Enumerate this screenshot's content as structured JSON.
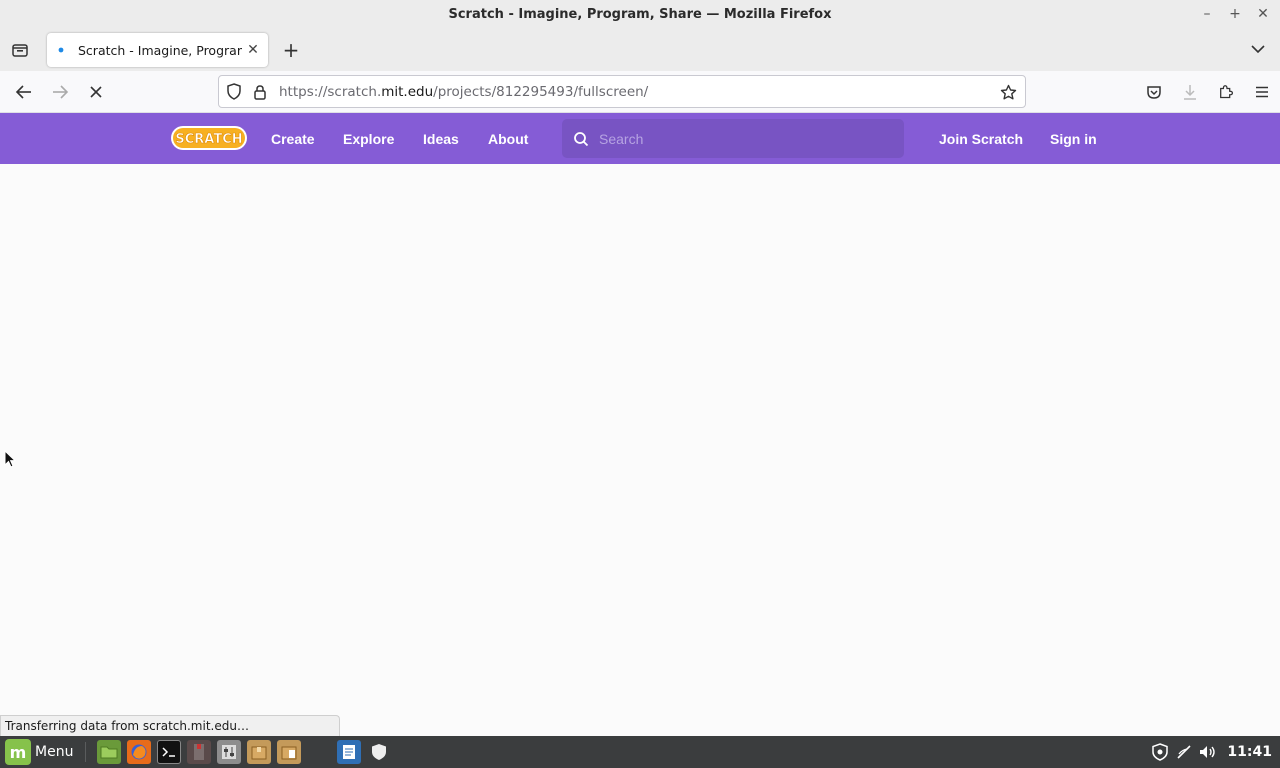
{
  "window": {
    "title": "Scratch - Imagine, Program, Share — Mozilla Firefox",
    "minimize_icon": "–",
    "maximize_icon": "+",
    "close_icon": "✕"
  },
  "tabs": [
    {
      "title": "Scratch - Imagine, Program, Share",
      "close": "✕"
    }
  ],
  "newtab_label": "+",
  "url": {
    "prefix": "https://scratch.",
    "host": "mit.edu",
    "path": "/projects/812295493/fullscreen/"
  },
  "scratch_nav": {
    "logo_text": "SCRATCH",
    "links": [
      "Create",
      "Explore",
      "Ideas",
      "About"
    ],
    "search_placeholder": "Search",
    "join": "Join Scratch",
    "sign_in": "Sign in"
  },
  "status_text": "Transferring data from scratch.mit.edu…",
  "taskbar": {
    "menu_label": "Menu",
    "clock": "11:41"
  },
  "colors": {
    "scratch_purple": "#855cd6",
    "scratch_search": "#7854c3",
    "taskbar_bg": "#3b3d3e",
    "mint_green": "#86c24b"
  }
}
